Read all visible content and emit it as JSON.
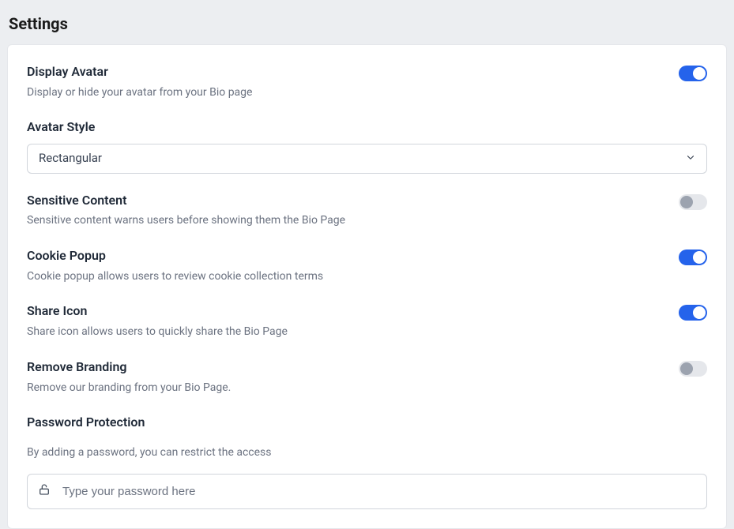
{
  "page": {
    "title": "Settings"
  },
  "settings": {
    "display_avatar": {
      "title": "Display Avatar",
      "desc": "Display or hide your avatar from your Bio page",
      "enabled": true
    },
    "avatar_style": {
      "title": "Avatar Style",
      "selected": "Rectangular"
    },
    "sensitive_content": {
      "title": "Sensitive Content",
      "desc": "Sensitive content warns users before showing them the Bio Page",
      "enabled": false
    },
    "cookie_popup": {
      "title": "Cookie Popup",
      "desc": "Cookie popup allows users to review cookie collection terms",
      "enabled": true
    },
    "share_icon": {
      "title": "Share Icon",
      "desc": "Share icon allows users to quickly share the Bio Page",
      "enabled": true
    },
    "remove_branding": {
      "title": "Remove Branding",
      "desc": "Remove our branding from your Bio Page.",
      "enabled": false
    },
    "password_protection": {
      "title": "Password Protection",
      "desc": "By adding a password, you can restrict the access",
      "placeholder": "Type your password here",
      "value": ""
    }
  }
}
